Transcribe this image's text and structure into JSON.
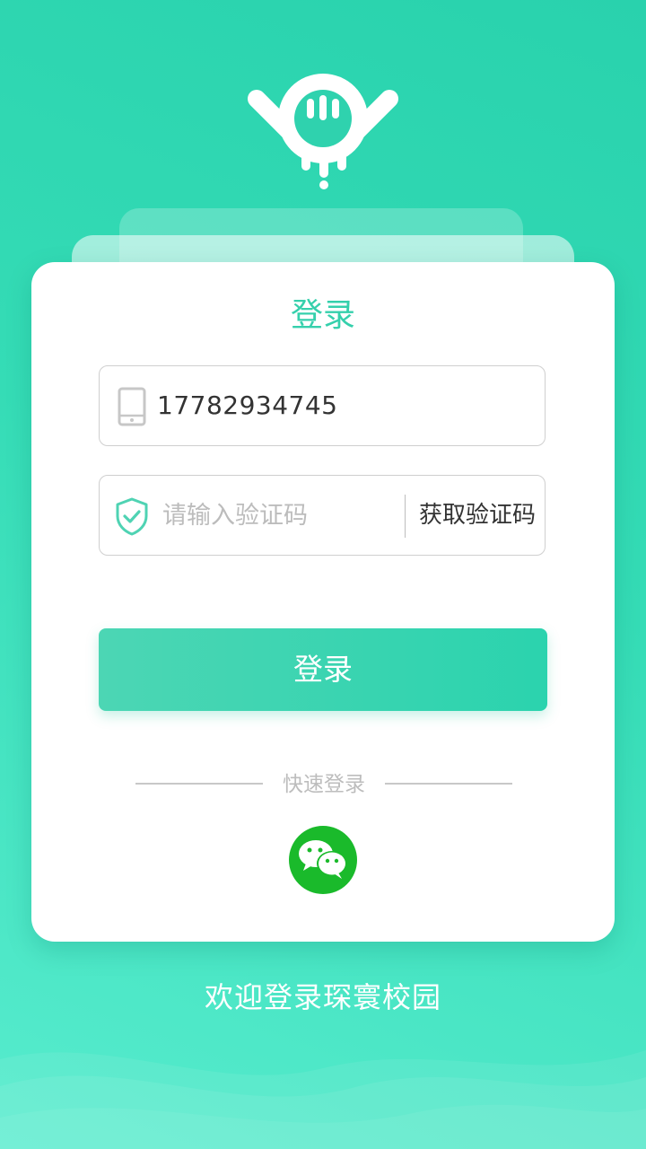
{
  "card": {
    "title": "登录"
  },
  "phone_field": {
    "value": "17782934745"
  },
  "code_field": {
    "placeholder": "请输入验证码",
    "get_code_label": "获取验证码"
  },
  "login_button": {
    "label": "登录"
  },
  "quick_login": {
    "label": "快速登录",
    "method_icon": "wechat-icon"
  },
  "welcome_text": "欢迎登录琛寰校园",
  "colors": {
    "accent": "#35d0ac",
    "wechat": "#1aba2b",
    "background": "#2ed4af"
  }
}
